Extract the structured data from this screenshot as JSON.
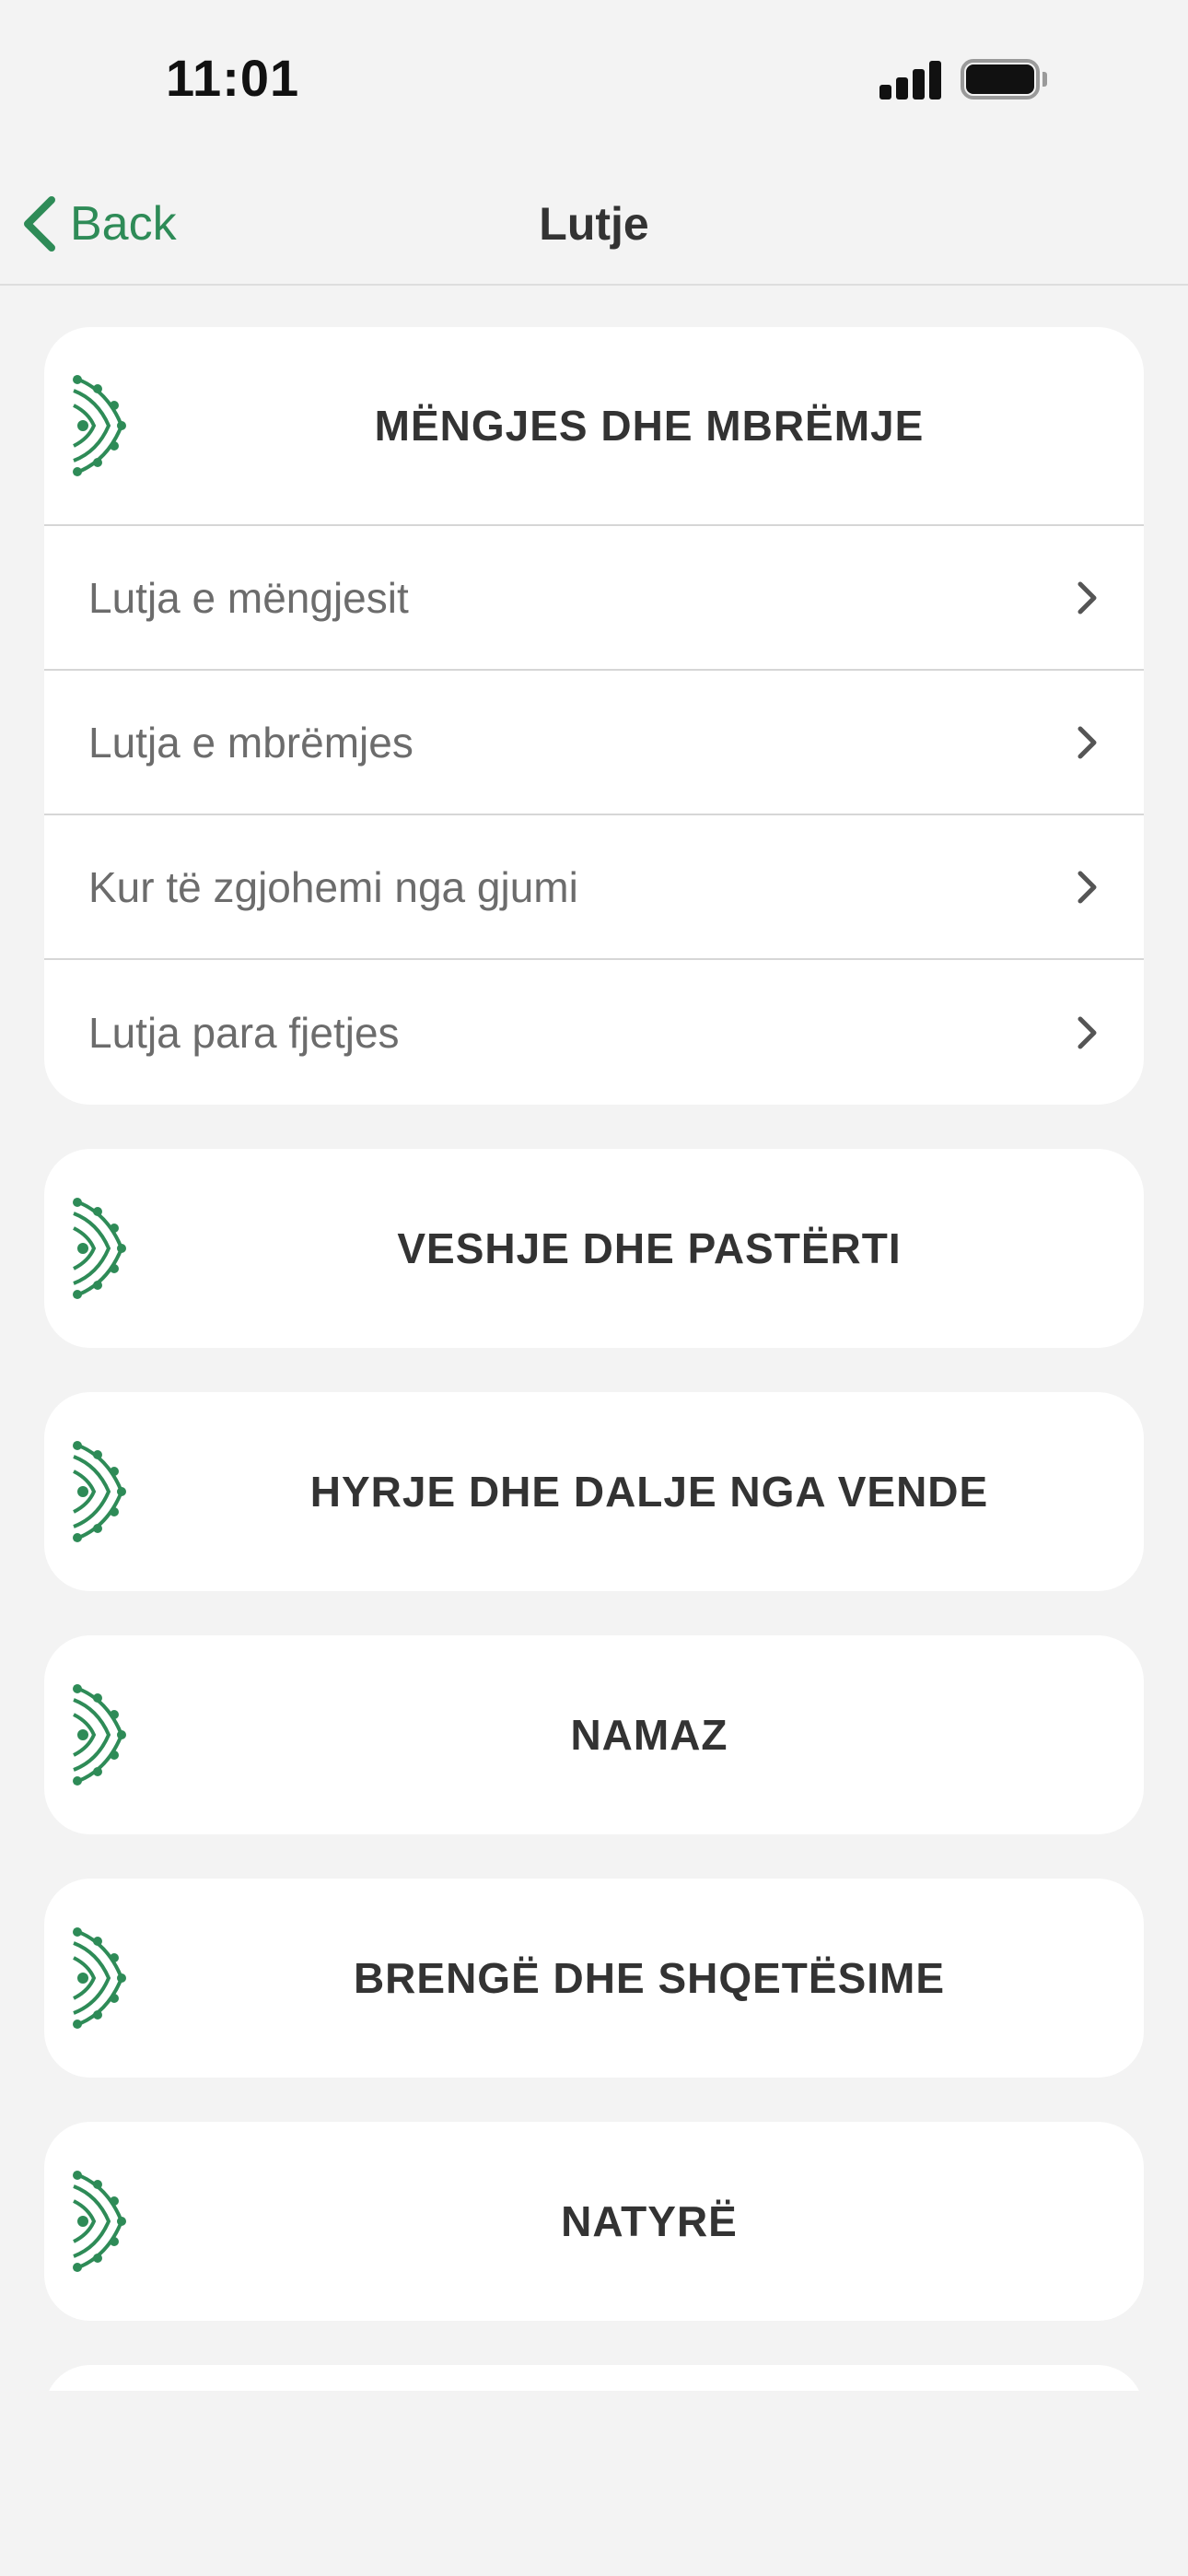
{
  "status_bar": {
    "time": "11:01"
  },
  "nav": {
    "back_label": "Back",
    "title": "Lutje"
  },
  "theme": {
    "accent": "#2e8b57",
    "background": "#f3f3f3",
    "card": "#ffffff"
  },
  "sections": [
    {
      "title": "MËNGJES DHE MBRËMJE",
      "icon": "ornament-icon",
      "items": [
        {
          "label": "Lutja e mëngjesit"
        },
        {
          "label": "Lutja e mbrëmjes"
        },
        {
          "label": "Kur të zgjohemi nga gjumi"
        },
        {
          "label": "Lutja para fjetjes"
        }
      ]
    },
    {
      "title": "VESHJE DHE PASTËRTI",
      "icon": "ornament-icon"
    },
    {
      "title": "HYRJE DHE DALJE NGA VENDE",
      "icon": "ornament-icon"
    },
    {
      "title": "NAMAZ",
      "icon": "ornament-icon"
    },
    {
      "title": "BRENGË DHE SHQETËSIME",
      "icon": "ornament-icon"
    },
    {
      "title": "NATYRË",
      "icon": "ornament-icon"
    }
  ]
}
